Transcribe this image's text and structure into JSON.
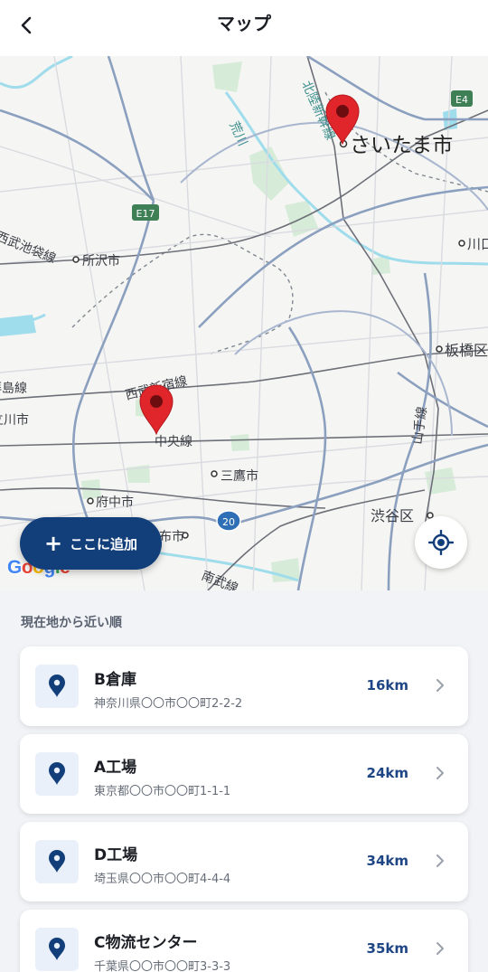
{
  "header": {
    "title": "マップ"
  },
  "map": {
    "labels": {
      "saitama": "さいたま市",
      "tokorozawa": "所沢市",
      "kawaguchi": "川口",
      "itabashi": "板橋区",
      "mitaka": "三鷹市",
      "fuchu": "府中市",
      "shibuya": "渋谷区",
      "chofu": "布市",
      "tachikawa": "立川市",
      "chuo_line": "中央線",
      "seibu_shinjuku": "西武新宿線",
      "seibu_ikebukuro": "西武池袋線",
      "haijima": "拝島線",
      "hokuriku_shinkansen": "北陸新幹線",
      "arakawa": "荒川",
      "yamanote": "山手線",
      "nambu": "南武線",
      "e17": "E17",
      "e4": "E4",
      "route20": "20"
    },
    "google": [
      "G",
      "o",
      "o",
      "g",
      "l",
      "e"
    ],
    "google_colors": [
      "#4285f4",
      "#ea4335",
      "#fbbc05",
      "#4285f4",
      "#34a853",
      "#ea4335"
    ]
  },
  "actions": {
    "add_here": "ここに追加"
  },
  "list": {
    "heading": "現在地から近い順",
    "items": [
      {
        "name": "B倉庫",
        "address": "神奈川県〇〇市〇〇町2-2-2",
        "distance": "16km"
      },
      {
        "name": "A工場",
        "address": "東京都〇〇市〇〇町1-1-1",
        "distance": "24km"
      },
      {
        "name": "D工場",
        "address": "埼玉県〇〇市〇〇町4-4-4",
        "distance": "34km"
      },
      {
        "name": "C物流センター",
        "address": "千葉県〇〇市〇〇町3-3-3",
        "distance": "35km"
      }
    ]
  },
  "colors": {
    "accent": "#123e7a",
    "distance": "#1f4684",
    "pin": "#e0252b",
    "icon_bg": "#e9f0fa"
  }
}
